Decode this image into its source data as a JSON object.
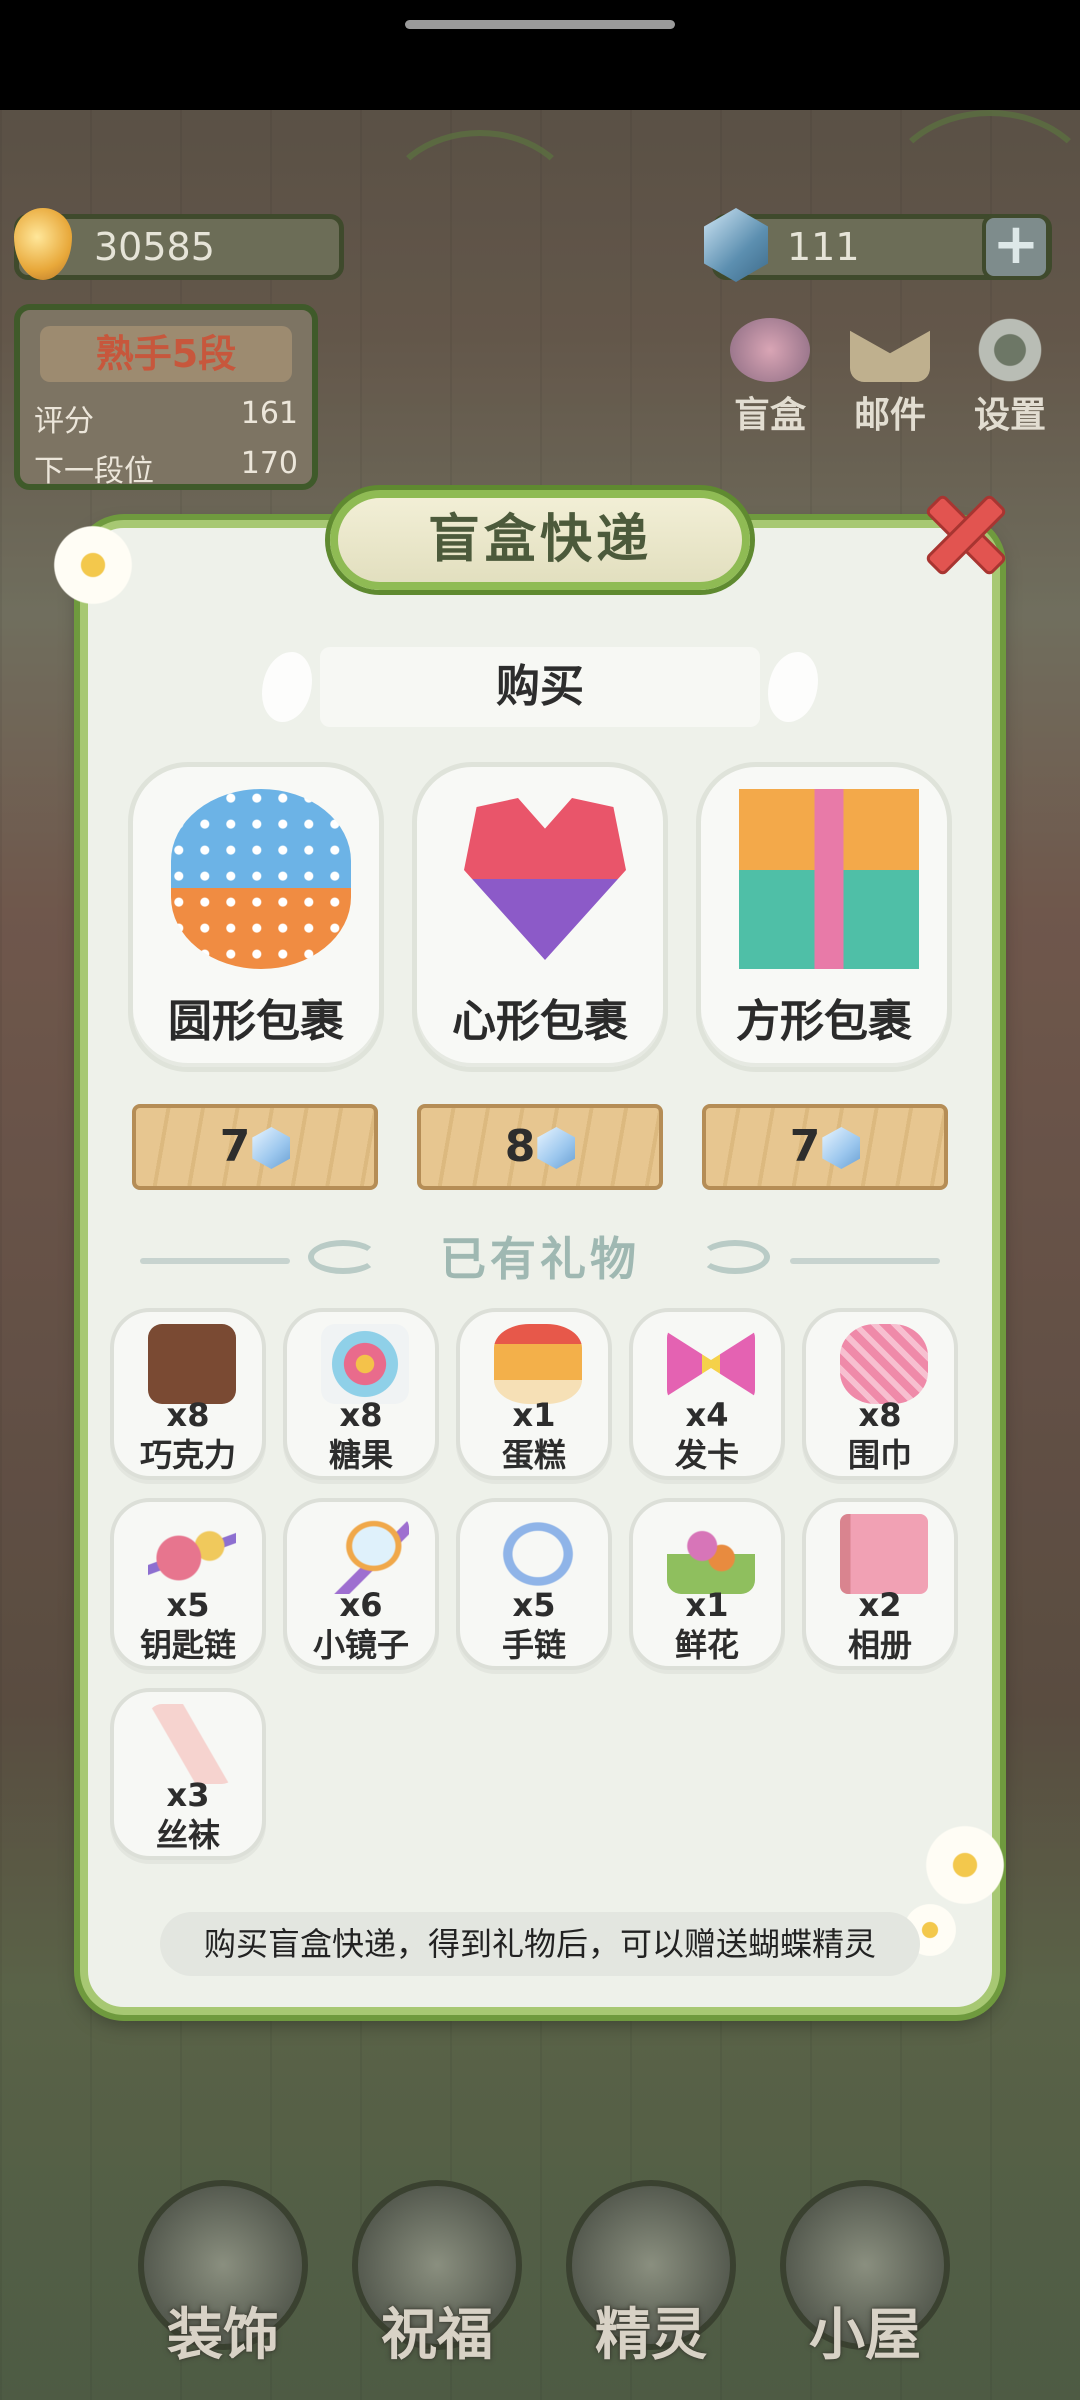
{
  "hud": {
    "coins": "30585",
    "gems": "111",
    "plus_label": "+",
    "rank": {
      "title": "熟手5段",
      "score_label": "评分",
      "score_value": "161",
      "next_label": "下一段位",
      "next_value": "170"
    },
    "top_icons": [
      {
        "label": "盲盒",
        "icon": "blind-box-icon"
      },
      {
        "label": "邮件",
        "icon": "mail-icon"
      },
      {
        "label": "设置",
        "icon": "gear-icon"
      }
    ]
  },
  "dialog": {
    "title": "盲盒快递",
    "buy_header": "购买",
    "packages": [
      {
        "name": "圆形包裹",
        "price": "7",
        "icon": "round-package-icon"
      },
      {
        "name": "心形包裹",
        "price": "8",
        "icon": "heart-package-icon"
      },
      {
        "name": "方形包裹",
        "price": "7",
        "icon": "square-package-icon"
      }
    ],
    "owned_title": "已有礼物",
    "gifts": [
      {
        "name": "巧克力",
        "count": "x8",
        "icon": "chocolate-icon",
        "color": "#7a4a33"
      },
      {
        "name": "糖果",
        "count": "x8",
        "icon": "candy-jar-icon",
        "color": "#e96b8c"
      },
      {
        "name": "蛋糕",
        "count": "x1",
        "icon": "cake-icon",
        "color": "#f3b04a"
      },
      {
        "name": "发卡",
        "count": "x4",
        "icon": "hair-clip-icon",
        "color": "#e462b2"
      },
      {
        "name": "围巾",
        "count": "x8",
        "icon": "scarf-icon",
        "color": "#ef8aa9"
      },
      {
        "name": "钥匙链",
        "count": "x5",
        "icon": "keychain-icon",
        "color": "#e7758e"
      },
      {
        "name": "小镜子",
        "count": "x6",
        "icon": "mirror-icon",
        "color": "#9e6fd0"
      },
      {
        "name": "手链",
        "count": "x5",
        "icon": "bracelet-icon",
        "color": "#8fb4e8"
      },
      {
        "name": "鲜花",
        "count": "x1",
        "icon": "flowers-icon",
        "color": "#d775b8"
      },
      {
        "name": "相册",
        "count": "x2",
        "icon": "album-icon",
        "color": "#f1a1b4"
      },
      {
        "name": "丝袜",
        "count": "x3",
        "icon": "stockings-icon",
        "color": "#f6d3cf"
      }
    ],
    "tip": "购买盲盒快递，得到礼物后，可以赠送蝴蝶精灵"
  },
  "bottom_nav": [
    {
      "label": "装饰",
      "icon": "plant-icon"
    },
    {
      "label": "祝福",
      "icon": "butterfly-icon"
    },
    {
      "label": "精灵",
      "icon": "fairy-icon"
    },
    {
      "label": "小屋",
      "icon": "house-icon"
    }
  ],
  "colors": {
    "dialog_border": "#a7c873",
    "dialog_bg": "#eef1ea",
    "close_red": "#e25450",
    "section_title": "#9fb8b2"
  }
}
